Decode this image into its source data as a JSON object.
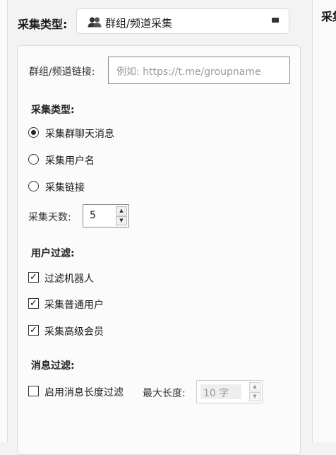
{
  "collect_type": {
    "label": "采集类型:",
    "selected": "群组/频道采集",
    "icon": "users-icon"
  },
  "right_panel_label": "采集",
  "link": {
    "label": "群组/频道链接:",
    "placeholder": "例如: https://t.me/groupname"
  },
  "mode_section": {
    "title": "采集类型:",
    "options": [
      {
        "label": "采集群聊天消息",
        "selected": true
      },
      {
        "label": "采集用户名",
        "selected": false
      },
      {
        "label": "采集链接",
        "selected": false
      }
    ]
  },
  "days": {
    "label": "采集天数:",
    "value": "5"
  },
  "user_filter": {
    "title": "用户过滤:",
    "items": [
      {
        "label": "过滤机器人",
        "checked": true
      },
      {
        "label": "采集普通用户",
        "checked": true
      },
      {
        "label": "采集高级会员",
        "checked": true
      }
    ]
  },
  "message_filter": {
    "title": "消息过滤:",
    "enable_label": "启用消息长度过滤",
    "enabled": false,
    "max_label": "最大长度:",
    "max_value": "10 字"
  }
}
